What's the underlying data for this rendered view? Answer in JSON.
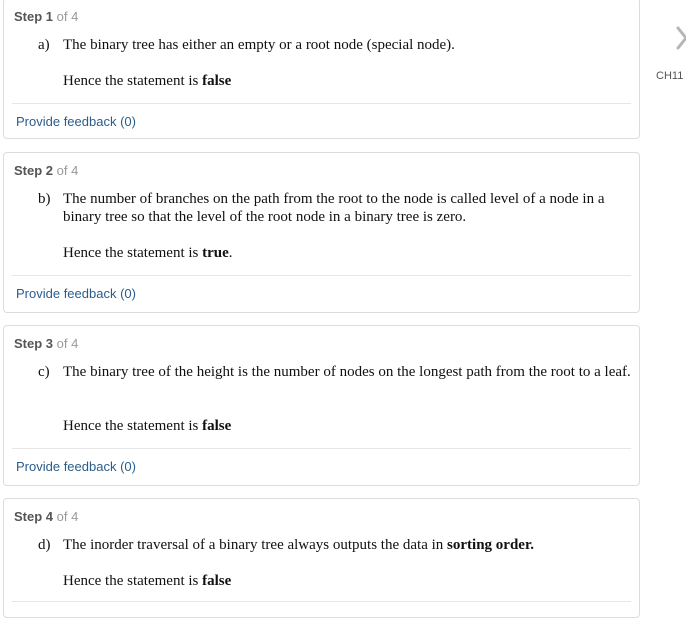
{
  "steps": [
    {
      "step_word": "Step",
      "num": "1",
      "of_text": "of 4",
      "marker": "a)",
      "statement": "The binary tree has either an empty or a root node (special node).",
      "verdict_prefix": "Hence the statement is ",
      "verdict_value": "false",
      "verdict_suffix": "",
      "feedback": "Provide feedback (0)"
    },
    {
      "step_word": "Step",
      "num": "2",
      "of_text": "of 4",
      "marker": "b)",
      "statement": "The number of branches on the path from the root to the node is called level of a node in a binary tree so that the level of the root node in a binary tree is zero.",
      "verdict_prefix": "Hence the statement is ",
      "verdict_value": "true",
      "verdict_suffix": ".",
      "feedback": "Provide feedback (0)"
    },
    {
      "step_word": "Step",
      "num": "3",
      "of_text": "of 4",
      "marker": "c)",
      "statement": "The binary tree of the height is the number of nodes on the longest path from the root to a leaf.",
      "verdict_prefix": "Hence the statement is ",
      "verdict_value": "false",
      "verdict_suffix": "",
      "feedback": "Provide feedback (0)"
    },
    {
      "step_word": "Step",
      "num": "4",
      "of_text": "of 4",
      "marker": "d)",
      "statement_prefix": "The inorder traversal of a binary tree always outputs the data in ",
      "statement_bold": "sorting order.",
      "verdict_prefix": "Hence the statement is ",
      "verdict_value": "false",
      "verdict_suffix": ""
    }
  ],
  "sidebar": {
    "next_icon": "chevron-right-icon",
    "chapter_label": "CH11"
  },
  "colors": {
    "link": "#2a5d8c",
    "muted": "#999999",
    "border": "#dcdcdc"
  }
}
